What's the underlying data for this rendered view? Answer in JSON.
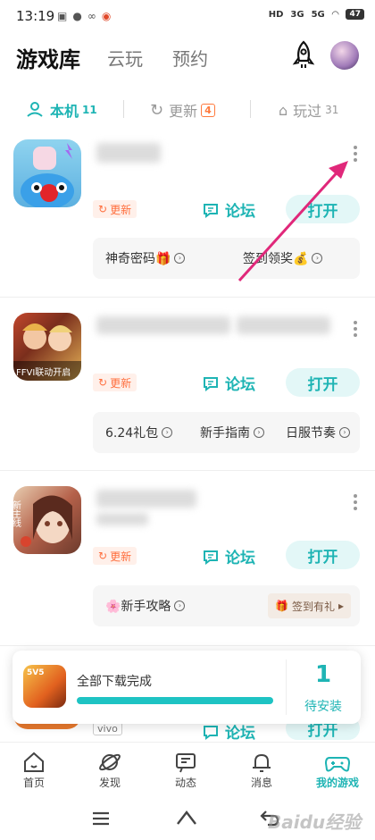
{
  "status_bar": {
    "time": "13:19",
    "network_left": "HD",
    "signal1": "3G",
    "signal2": "5G",
    "battery": "47"
  },
  "header": {
    "tabs": [
      "游戏库",
      "云玩",
      "预约"
    ]
  },
  "filters": [
    {
      "label": "本机",
      "count": "11"
    },
    {
      "label": "更新",
      "count": "4"
    },
    {
      "label": "玩过",
      "count": "31"
    }
  ],
  "games": [
    {
      "update_label": "更新",
      "forum_label": "论坛",
      "open_label": "打开",
      "subs": [
        "神奇密码🎁",
        "签到领奖💰"
      ]
    },
    {
      "update_label": "更新",
      "forum_label": "论坛",
      "open_label": "打开",
      "subs": [
        "6.24礼包",
        "新手指南",
        "日服节奏"
      ],
      "icon_text": "FFVI联动开启"
    },
    {
      "update_label": "更新",
      "forum_label": "论坛",
      "open_label": "打开",
      "subs": [
        "🌸新手攻略"
      ],
      "sign_label": "签到有礼",
      "icon_text": "新主线"
    }
  ],
  "fourth_game": {
    "tag": "vivo",
    "forum_label": "论坛",
    "open_label": "打开"
  },
  "download_toast": {
    "title": "全部下载完成",
    "progress": 1.0,
    "count": "1",
    "label": "待安装"
  },
  "bottom_nav": [
    {
      "label": "首页",
      "icon": "home-icon"
    },
    {
      "label": "发现",
      "icon": "discover-icon"
    },
    {
      "label": "动态",
      "icon": "feed-icon"
    },
    {
      "label": "消息",
      "icon": "bell-icon"
    },
    {
      "label": "我的游戏",
      "icon": "gamepad-icon"
    }
  ],
  "colors": {
    "accent": "#1eb4b4",
    "update": "#ff6e3d",
    "annotation": "#e0287a"
  },
  "watermark": "Baidu经验"
}
